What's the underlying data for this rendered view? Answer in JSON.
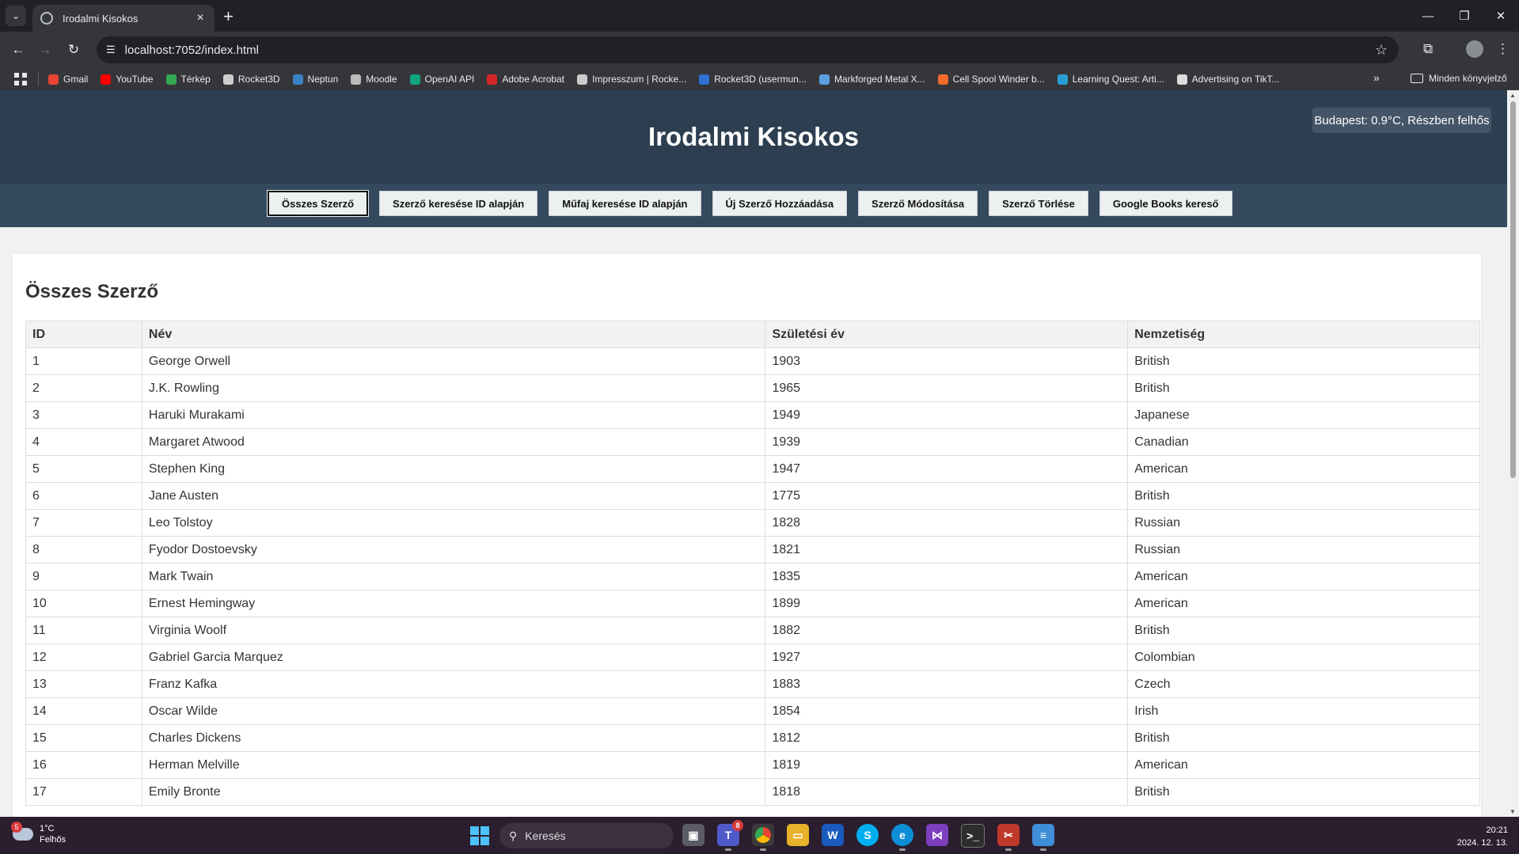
{
  "browser": {
    "tab_title": "Irodalmi Kisokos",
    "url": "localhost:7052/index.html",
    "bookmarks": [
      {
        "label": "Gmail",
        "color": "#ea4335"
      },
      {
        "label": "YouTube",
        "color": "#ff0000"
      },
      {
        "label": "Térkép",
        "color": "#34a853"
      },
      {
        "label": "Rocket3D",
        "color": "#cccccc"
      },
      {
        "label": "Neptun",
        "color": "#3b82c4"
      },
      {
        "label": "Moodle",
        "color": "#bbbbbb"
      },
      {
        "label": "OpenAI API",
        "color": "#10a37f"
      },
      {
        "label": "Adobe Acrobat",
        "color": "#d4252b"
      },
      {
        "label": "Impresszum | Rocke...",
        "color": "#cccccc"
      },
      {
        "label": "Rocket3D (usermun...",
        "color": "#2f6fd6"
      },
      {
        "label": "Markforged Metal X...",
        "color": "#5aa0e0"
      },
      {
        "label": "Cell Spool Winder b...",
        "color": "#f26b2a"
      },
      {
        "label": "Learning Quest: Arti...",
        "color": "#2a9fd6"
      },
      {
        "label": "Advertising on TikT...",
        "color": "#dddddd"
      }
    ],
    "all_bookmarks_label": "Minden könyvjelző"
  },
  "site": {
    "title": "Irodalmi Kisokos",
    "weather": "Budapest: 0.9°C, Részben felhős",
    "nav": [
      "Összes Szerző",
      "Szerző keresése ID alapján",
      "Műfaj keresése ID alapján",
      "Új Szerző Hozzáadása",
      "Szerző Módosítása",
      "Szerző Törlése",
      "Google Books kereső"
    ]
  },
  "content": {
    "title": "Összes Szerző",
    "columns": [
      "ID",
      "Név",
      "Születési év",
      "Nemzetiség"
    ],
    "rows": [
      [
        "1",
        "George Orwell",
        "1903",
        "British"
      ],
      [
        "2",
        "J.K. Rowling",
        "1965",
        "British"
      ],
      [
        "3",
        "Haruki Murakami",
        "1949",
        "Japanese"
      ],
      [
        "4",
        "Margaret Atwood",
        "1939",
        "Canadian"
      ],
      [
        "5",
        "Stephen King",
        "1947",
        "American"
      ],
      [
        "6",
        "Jane Austen",
        "1775",
        "British"
      ],
      [
        "7",
        "Leo Tolstoy",
        "1828",
        "Russian"
      ],
      [
        "8",
        "Fyodor Dostoevsky",
        "1821",
        "Russian"
      ],
      [
        "9",
        "Mark Twain",
        "1835",
        "American"
      ],
      [
        "10",
        "Ernest Hemingway",
        "1899",
        "American"
      ],
      [
        "11",
        "Virginia Woolf",
        "1882",
        "British"
      ],
      [
        "12",
        "Gabriel Garcia Marquez",
        "1927",
        "Colombian"
      ],
      [
        "13",
        "Franz Kafka",
        "1883",
        "Czech"
      ],
      [
        "14",
        "Oscar Wilde",
        "1854",
        "Irish"
      ],
      [
        "15",
        "Charles Dickens",
        "1812",
        "British"
      ],
      [
        "16",
        "Herman Melville",
        "1819",
        "American"
      ],
      [
        "17",
        "Emily Bronte",
        "1818",
        "British"
      ]
    ]
  },
  "taskbar": {
    "weather_temp": "1°C",
    "weather_desc": "Felhős",
    "weather_badge": "5",
    "search_placeholder": "Keresés",
    "teams_badge": "8",
    "time": "20:21",
    "date": "2024. 12. 13."
  },
  "colors": {
    "header_bg": "#2c3e50",
    "nav_bg": "#34495e"
  }
}
